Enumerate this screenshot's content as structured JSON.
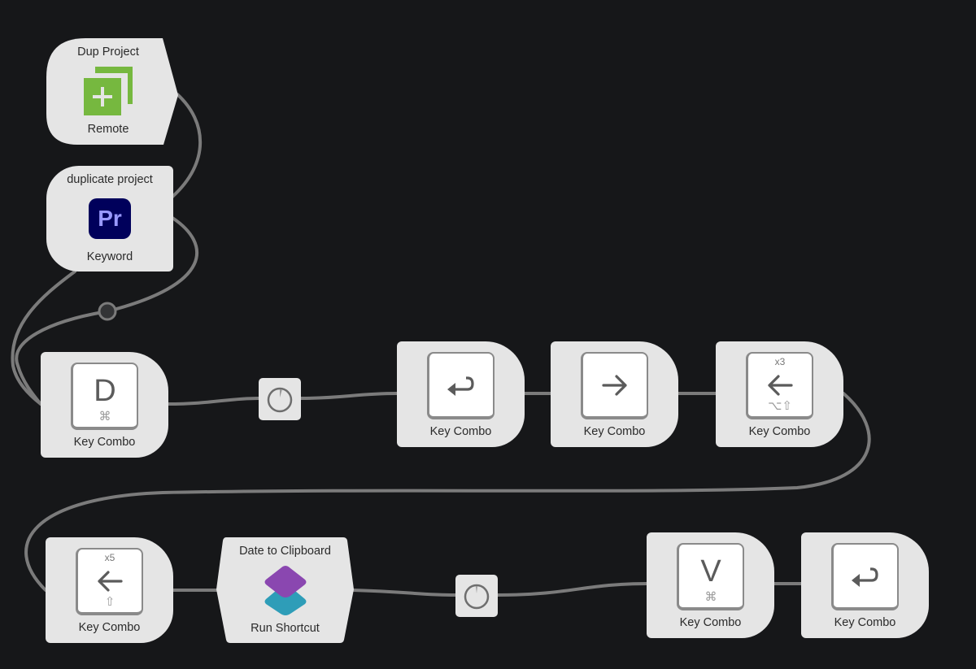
{
  "canvas": {
    "background": "#161719",
    "wire_color": "#7b7b7b",
    "node_color": "#e5e5e5"
  },
  "nodes": {
    "dup_project": {
      "title": "Dup Project",
      "subtitle": "Remote",
      "icon": "duplicate-plus-icon",
      "icon_color": "#76b83f"
    },
    "duplicate_project": {
      "title": "duplicate project",
      "subtitle": "Keyword",
      "icon": "premiere-pro-app-icon",
      "icon_text": "Pr",
      "icon_bg": "#00005b",
      "icon_fg": "#9999ff"
    },
    "key_d": {
      "subtitle": "Key Combo",
      "key": "D",
      "modifiers": "⌘"
    },
    "delay_1": {
      "icon": "delay-dial-icon"
    },
    "key_return_1": {
      "subtitle": "Key Combo",
      "key": "return",
      "glyph": "↩"
    },
    "key_right": {
      "subtitle": "Key Combo",
      "key": "right-arrow",
      "glyph": "→"
    },
    "key_left_x3": {
      "subtitle": "Key Combo",
      "key": "left-arrow",
      "glyph": "←",
      "repeat": "x3",
      "modifiers": "⌥⇧"
    },
    "key_left_x5": {
      "subtitle": "Key Combo",
      "key": "left-arrow",
      "glyph": "←",
      "repeat": "x5",
      "modifiers": "⇧"
    },
    "run_shortcut": {
      "title": "Date to Clipboard",
      "subtitle": "Run Shortcut",
      "icon": "shortcuts-app-icon",
      "icon_top": "#8a47b0",
      "icon_bottom": "#2e9db8"
    },
    "delay_2": {
      "icon": "delay-dial-icon"
    },
    "key_v": {
      "subtitle": "Key Combo",
      "key": "V",
      "modifiers": "⌘"
    },
    "key_return_2": {
      "subtitle": "Key Combo",
      "key": "return",
      "glyph": "↩"
    }
  }
}
